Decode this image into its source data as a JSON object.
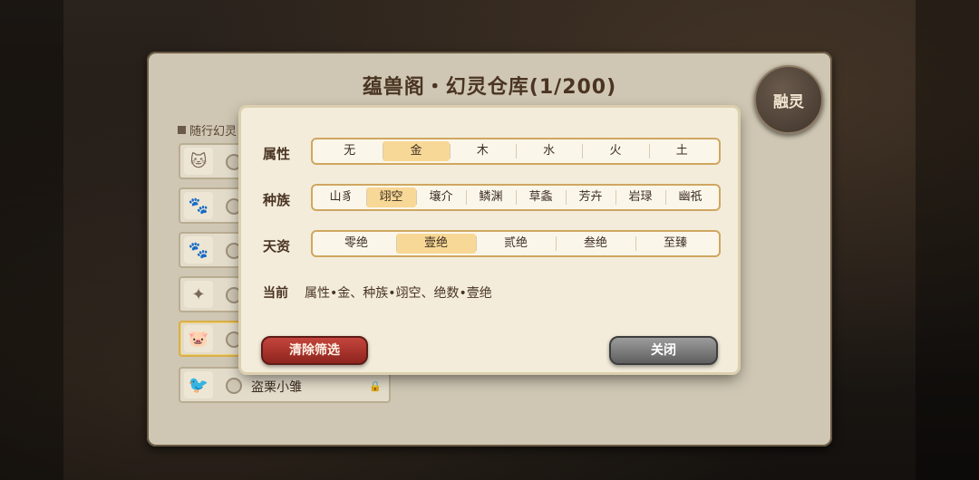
{
  "panel": {
    "title": "蕴兽阁・幻灵仓库(1/200)",
    "fuse_button": "融灵",
    "follow_label": "随行幻灵"
  },
  "pets": [
    {
      "avatar_icon": "cat-icon",
      "name": ""
    },
    {
      "avatar_icon": "beast-icon",
      "name": ""
    },
    {
      "avatar_icon": "beast-icon",
      "name": ""
    },
    {
      "avatar_icon": "spirit-icon",
      "name": ""
    },
    {
      "avatar_icon": "pig-icon",
      "name": ""
    },
    {
      "avatar_icon": "bird-icon",
      "name": "盗栗小雏"
    }
  ],
  "filter": {
    "attribute_label": "属性",
    "attribute_options": [
      "无",
      "金",
      "木",
      "水",
      "火",
      "土"
    ],
    "attribute_selected": "金",
    "race_label": "种族",
    "race_options": [
      "山豸",
      "翊空",
      "壤介",
      "鳞渊",
      "草螽",
      "芳卉",
      "岩琭",
      "幽祇"
    ],
    "race_selected": "翊空",
    "talent_label": "天资",
    "talent_options": [
      "零绝",
      "壹绝",
      "贰绝",
      "叁绝",
      "至臻"
    ],
    "talent_selected": "壹绝",
    "current_label": "当前",
    "current_value": "属性•金、种族•翊空、绝数•壹绝",
    "clear_button": "清除筛选",
    "close_button": "关闭"
  },
  "colors": {
    "accent_gold": "#f7d896",
    "clear_red": "#c4453c",
    "close_gray": "#8a8a8a"
  }
}
